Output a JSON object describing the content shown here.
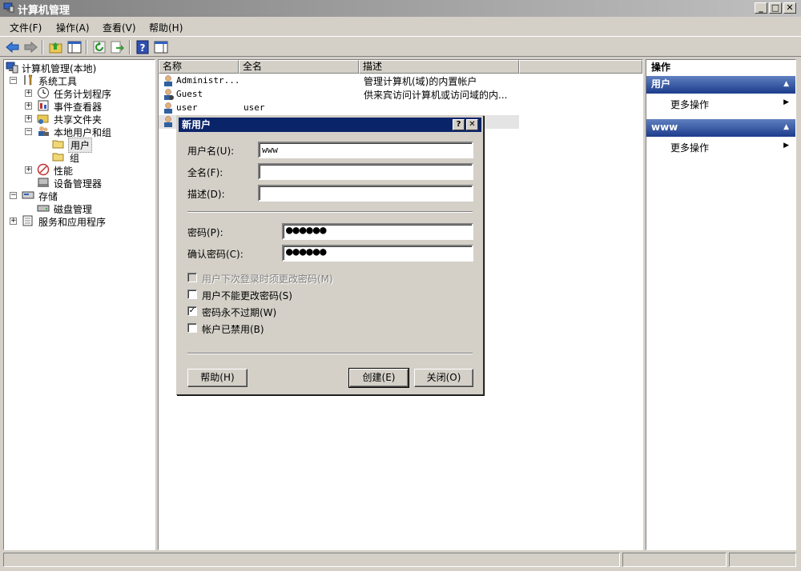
{
  "window": {
    "title": "计算机管理"
  },
  "menu": [
    "文件(F)",
    "操作(A)",
    "查看(V)",
    "帮助(H)"
  ],
  "tree": {
    "root": "计算机管理(本地)",
    "system_tools": "系统工具",
    "task_scheduler": "任务计划程序",
    "event_viewer": "事件查看器",
    "shared_folders": "共享文件夹",
    "local_users_groups": "本地用户和组",
    "users": "用户",
    "groups": "组",
    "performance": "性能",
    "device_manager": "设备管理器",
    "storage": "存储",
    "disk_management": "磁盘管理",
    "services_apps": "服务和应用程序"
  },
  "list": {
    "columns": [
      "名称",
      "全名",
      "描述"
    ],
    "rows": [
      {
        "name": "Administr...",
        "fullname": "",
        "desc": "管理计算机(域)的内置帐户"
      },
      {
        "name": "Guest",
        "fullname": "",
        "desc": "供来宾访问计算机或访问域的内..."
      },
      {
        "name": "user",
        "fullname": "user",
        "desc": ""
      }
    ]
  },
  "actions": {
    "header": "操作",
    "groups": [
      {
        "title": "用户",
        "item": "更多操作"
      },
      {
        "title": "www",
        "item": "更多操作"
      }
    ]
  },
  "dialog": {
    "title": "新用户",
    "help_glyph": "?",
    "close_glyph": "✕",
    "username_label": "用户名(U):",
    "username_value": "www",
    "fullname_label": "全名(F):",
    "fullname_value": "",
    "desc_label": "描述(D):",
    "desc_value": "",
    "password_label": "密码(P):",
    "password_value": "●●●●●●",
    "confirm_label": "确认密码(C):",
    "confirm_value": "●●●●●●",
    "options": [
      {
        "label": "用户下次登录时须更改密码(M)",
        "checked": false,
        "disabled": true
      },
      {
        "label": "用户不能更改密码(S)",
        "checked": false,
        "disabled": false
      },
      {
        "label": "密码永不过期(W)",
        "checked": true,
        "disabled": false
      },
      {
        "label": "帐户已禁用(B)",
        "checked": false,
        "disabled": false
      }
    ],
    "help_button": "帮助(H)",
    "create_button": "创建(E)",
    "close_button": "关闭(O)"
  },
  "glyphs": {
    "check": "✓",
    "arrow": "▶",
    "collapse": "▲",
    "minus": "−",
    "plus": "+"
  }
}
